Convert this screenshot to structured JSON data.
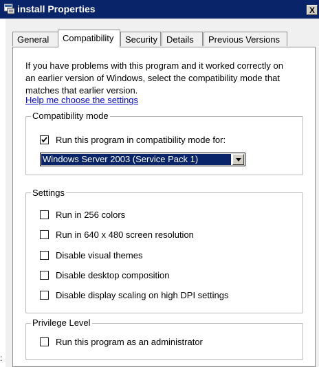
{
  "window": {
    "title": "install Properties",
    "close_label": "X",
    "icon": "properties-icon"
  },
  "tabs": [
    {
      "label": "General",
      "active": false
    },
    {
      "label": "Compatibility",
      "active": true
    },
    {
      "label": "Security",
      "active": false
    },
    {
      "label": "Details",
      "active": false
    },
    {
      "label": "Previous Versions",
      "active": false
    }
  ],
  "intro": {
    "text": "If you have problems with this program and it worked correctly on an earlier version of Windows, select the compatibility mode that matches that earlier version.",
    "help_link": "Help me choose the settings"
  },
  "compat_mode": {
    "group_label": "Compatibility mode",
    "checkbox_label": "Run this program in compatibility mode for:",
    "checked": true,
    "selected_os": "Windows Server 2003 (Service Pack 1)"
  },
  "settings": {
    "group_label": "Settings",
    "items": [
      {
        "label": "Run in 256 colors",
        "checked": false
      },
      {
        "label": "Run in 640 x 480 screen resolution",
        "checked": false
      },
      {
        "label": "Disable visual themes",
        "checked": false
      },
      {
        "label": "Disable desktop composition",
        "checked": false
      },
      {
        "label": "Disable display scaling on high DPI settings",
        "checked": false
      }
    ]
  },
  "privilege": {
    "group_label": "Privilege Level",
    "checkbox_label": "Run this program as an administrator",
    "checked": false
  },
  "stray_mark": ":"
}
